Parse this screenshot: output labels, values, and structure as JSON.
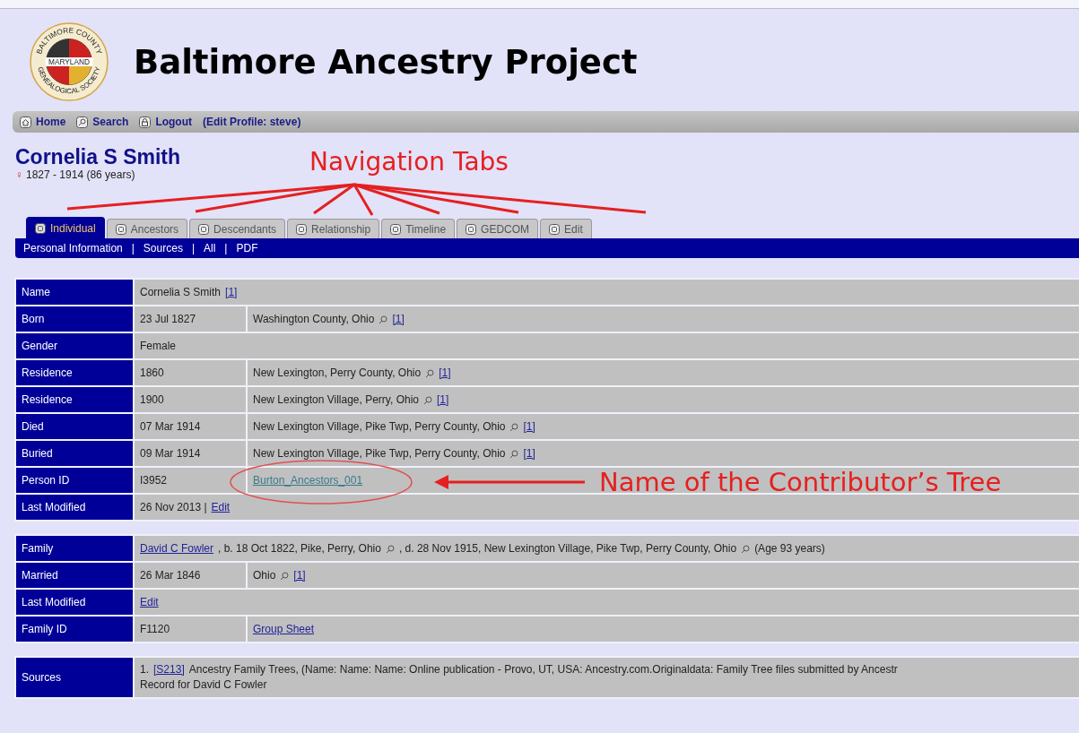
{
  "site": {
    "title": "Baltimore Ancestry Project",
    "logo": {
      "top_text": "BALTIMORE COUNTY",
      "middle_text": "MARYLAND",
      "bottom_text": "GENEALOGICAL SOCIETY"
    }
  },
  "topnav": {
    "items": [
      {
        "kind": "home",
        "label": "Home"
      },
      {
        "kind": "search",
        "label": "Search"
      },
      {
        "kind": "lock",
        "label": "Logout"
      }
    ],
    "profile_link": "(Edit Profile: steve)"
  },
  "person": {
    "name": "Cornelia S Smith",
    "sex_symbol": "♀",
    "lifespan": "1827 - 1914  (86 years)"
  },
  "tabs": [
    {
      "label": "Individual",
      "selected": true
    },
    {
      "label": "Ancestors",
      "selected": false
    },
    {
      "label": "Descendants",
      "selected": false
    },
    {
      "label": "Relationship",
      "selected": false
    },
    {
      "label": "Timeline",
      "selected": false
    },
    {
      "label": "GEDCOM",
      "selected": false
    },
    {
      "label": "Edit",
      "selected": false
    }
  ],
  "subnav": {
    "links": [
      "Personal Information",
      "Sources",
      "All",
      "PDF"
    ],
    "separators": [
      "|",
      "|",
      "|"
    ]
  },
  "tables": [
    {
      "rows": [
        {
          "label": "Name",
          "cells": [
            {
              "colspan": 2,
              "parts": [
                {
                  "kind": "text",
                  "text": "Cornelia S Smith"
                },
                {
                  "kind": "link",
                  "text": "[1]"
                }
              ]
            }
          ]
        },
        {
          "label": "Born",
          "cells": [
            {
              "parts": [
                {
                  "kind": "text",
                  "text": "23 Jul 1827"
                }
              ]
            },
            {
              "parts": [
                {
                  "kind": "text",
                  "text": "Washington County, Ohio"
                },
                {
                  "kind": "search"
                },
                {
                  "kind": "link",
                  "text": "[1]"
                }
              ]
            }
          ]
        },
        {
          "label": "Gender",
          "cells": [
            {
              "colspan": 2,
              "parts": [
                {
                  "kind": "text",
                  "text": "Female"
                }
              ]
            }
          ]
        },
        {
          "label": "Residence",
          "cells": [
            {
              "parts": [
                {
                  "kind": "text",
                  "text": "1860"
                }
              ]
            },
            {
              "parts": [
                {
                  "kind": "text",
                  "text": "New Lexington, Perry County, Ohio"
                },
                {
                  "kind": "search"
                },
                {
                  "kind": "link",
                  "text": "[1]"
                }
              ]
            }
          ]
        },
        {
          "label": "Residence",
          "cells": [
            {
              "parts": [
                {
                  "kind": "text",
                  "text": "1900"
                }
              ]
            },
            {
              "parts": [
                {
                  "kind": "text",
                  "text": "New Lexington Village, Perry, Ohio"
                },
                {
                  "kind": "search"
                },
                {
                  "kind": "link",
                  "text": "[1]"
                }
              ]
            }
          ]
        },
        {
          "label": "Died",
          "cells": [
            {
              "parts": [
                {
                  "kind": "text",
                  "text": "07 Mar 1914"
                }
              ]
            },
            {
              "parts": [
                {
                  "kind": "text",
                  "text": "New Lexington Village, Pike Twp, Perry County, Ohio"
                },
                {
                  "kind": "search"
                },
                {
                  "kind": "link",
                  "text": "[1]"
                }
              ]
            }
          ]
        },
        {
          "label": "Buried",
          "cells": [
            {
              "parts": [
                {
                  "kind": "text",
                  "text": "09 Mar 1914"
                }
              ]
            },
            {
              "parts": [
                {
                  "kind": "text",
                  "text": "New Lexington Village, Pike Twp, Perry County, Ohio"
                },
                {
                  "kind": "search"
                },
                {
                  "kind": "link",
                  "text": "[1]"
                }
              ]
            }
          ]
        },
        {
          "label": "Person ID",
          "cells": [
            {
              "parts": [
                {
                  "kind": "text",
                  "text": "I3952"
                }
              ]
            },
            {
              "parts": [
                {
                  "kind": "visited",
                  "text": "Burton_Ancestors_001"
                }
              ]
            }
          ]
        },
        {
          "label": "Last Modified",
          "cells": [
            {
              "colspan": 2,
              "parts": [
                {
                  "kind": "text",
                  "text": "26 Nov 2013 |"
                },
                {
                  "kind": "link",
                  "text": "Edit"
                }
              ]
            }
          ]
        }
      ]
    },
    {
      "rows": [
        {
          "label": "Family",
          "cells": [
            {
              "colspan": 2,
              "parts": [
                {
                  "kind": "link",
                  "text": "David C Fowler"
                },
                {
                  "kind": "text",
                  "text": ",  b. 18 Oct 1822, Pike, Perry, Ohio"
                },
                {
                  "kind": "search"
                },
                {
                  "kind": "text",
                  "text": ",  d. 28 Nov 1915, New Lexington Village, Pike Twp, Perry County, Ohio"
                },
                {
                  "kind": "search"
                },
                {
                  "kind": "text",
                  "text": "(Age 93 years)"
                }
              ]
            }
          ]
        },
        {
          "label": "Married",
          "cells": [
            {
              "parts": [
                {
                  "kind": "text",
                  "text": "26 Mar 1846"
                }
              ]
            },
            {
              "parts": [
                {
                  "kind": "text",
                  "text": "Ohio"
                },
                {
                  "kind": "search"
                },
                {
                  "kind": "link",
                  "text": "[1]"
                }
              ]
            }
          ]
        },
        {
          "label": "Last Modified",
          "cells": [
            {
              "colspan": 2,
              "parts": [
                {
                  "kind": "link",
                  "text": "Edit"
                }
              ]
            }
          ]
        },
        {
          "label": "Family ID",
          "cells": [
            {
              "parts": [
                {
                  "kind": "text",
                  "text": "F1120"
                }
              ]
            },
            {
              "parts": [
                {
                  "kind": "link",
                  "text": "Group Sheet"
                }
              ]
            }
          ]
        }
      ]
    },
    {
      "rows": [
        {
          "label": "Sources",
          "cells": [
            {
              "colspan": 2,
              "parts": [
                {
                  "kind": "text",
                  "text": "1."
                },
                {
                  "kind": "link",
                  "text": "[S213]"
                },
                {
                  "kind": "text",
                  "text": "Ancestry Family Trees, (Name: Name: Name: Online publication - Provo, UT, USA: Ancestry.com.Originaldata: Family Tree files submitted by Ancestr"
                },
                {
                  "kind": "break"
                },
                {
                  "kind": "text",
                  "text": "Record for David C Fowler"
                }
              ]
            }
          ]
        }
      ]
    }
  ],
  "annotations": [
    {
      "kind": "tabs-callout",
      "text": "Navigation Tabs"
    },
    {
      "kind": "tree-callout",
      "text": "Name of the Contributor’s Tree"
    }
  ]
}
